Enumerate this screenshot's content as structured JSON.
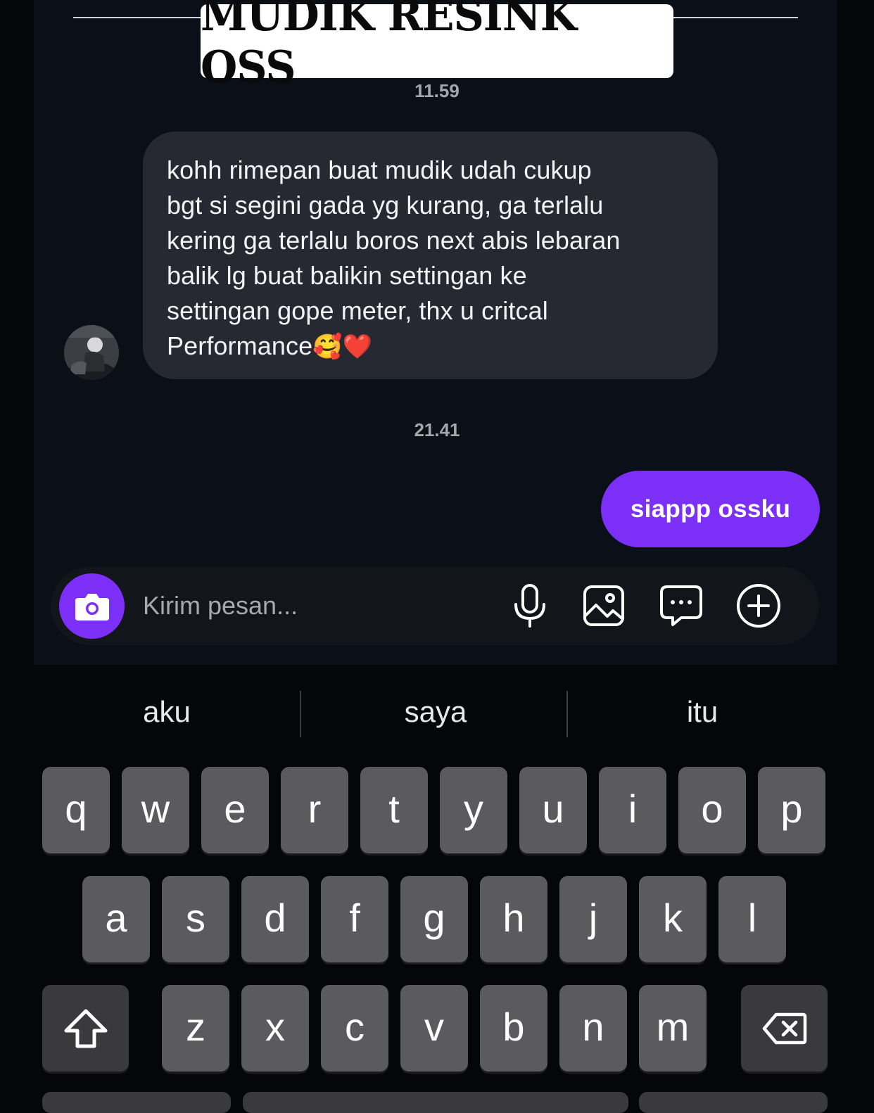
{
  "header": {
    "title": "MUDIK RESINK OSS"
  },
  "messages": [
    {
      "time": "11.59"
    },
    {
      "direction": "incoming",
      "text": "kohh rimepan buat mudik udah cukup\nbgt si segini gada yg kurang, ga terlalu\nkering ga terlalu boros next abis lebaran\nbalik lg buat balikin settingan ke\nsettingan gope meter, thx u critcal\nPerformance",
      "emoji": "🥰❤️"
    },
    {
      "time": "21.41"
    },
    {
      "direction": "outgoing",
      "text": "siappp ossku"
    }
  ],
  "composer": {
    "placeholder": "Kirim pesan...",
    "icons": [
      "camera-icon",
      "microphone-icon",
      "gallery-icon",
      "sticker-icon",
      "plus-icon"
    ],
    "accent": "#7b2ff7"
  },
  "keyboard": {
    "suggestions": [
      "aku",
      "saya",
      "itu"
    ],
    "rows": [
      [
        "q",
        "w",
        "e",
        "r",
        "t",
        "y",
        "u",
        "i",
        "o",
        "p"
      ],
      [
        "a",
        "s",
        "d",
        "f",
        "g",
        "h",
        "j",
        "k",
        "l"
      ],
      [
        "z",
        "x",
        "c",
        "v",
        "b",
        "n",
        "m"
      ]
    ],
    "special_keys": [
      "shift-icon",
      "backspace-icon"
    ]
  }
}
